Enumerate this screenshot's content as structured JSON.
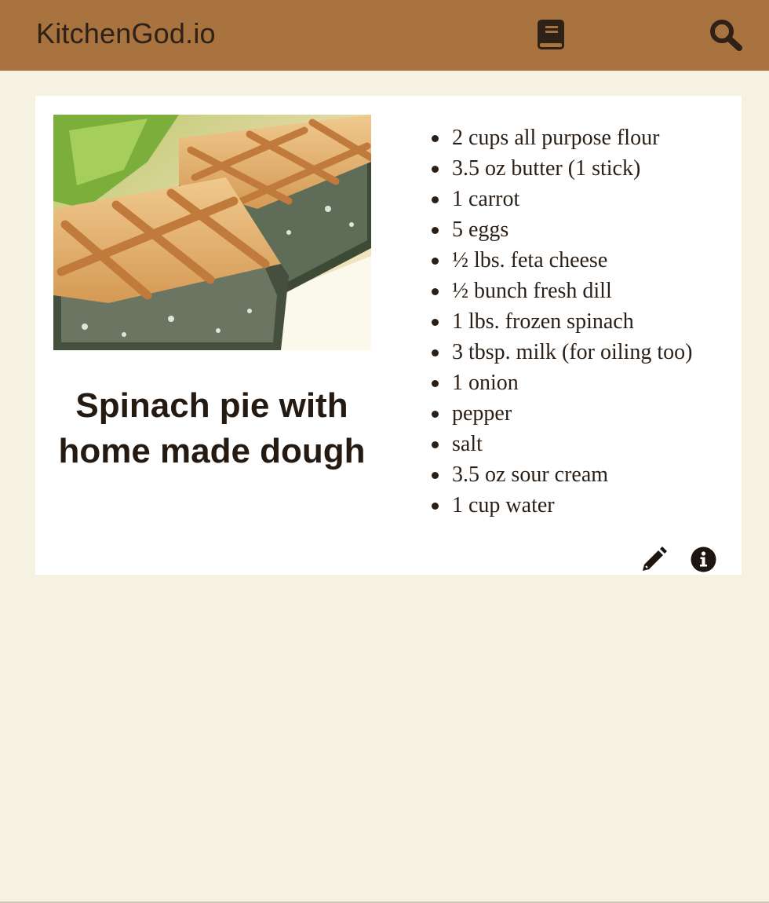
{
  "header": {
    "brand": "KitchenGod.io",
    "icons": [
      "book-icon",
      "search-icon"
    ],
    "background_color": "#a8733f"
  },
  "recipe": {
    "title": "Spinach pie with home made dough",
    "ingredients": [
      "2 cups all purpose flour",
      "3.5 oz butter (1 stick)",
      "1 carrot",
      "5 eggs",
      "½ lbs. feta cheese",
      "½ bunch fresh dill",
      "1 lbs. frozen spinach",
      "3 tbsp. milk (for oiling too)",
      "1 onion",
      "pepper",
      "salt",
      "3.5 oz sour cream",
      "1 cup water"
    ],
    "actions": [
      "pencil-icon",
      "info-icon"
    ]
  },
  "colors": {
    "page_background": "#f5f2e1",
    "card_background": "#ffffff",
    "text": "#2a1f16"
  }
}
